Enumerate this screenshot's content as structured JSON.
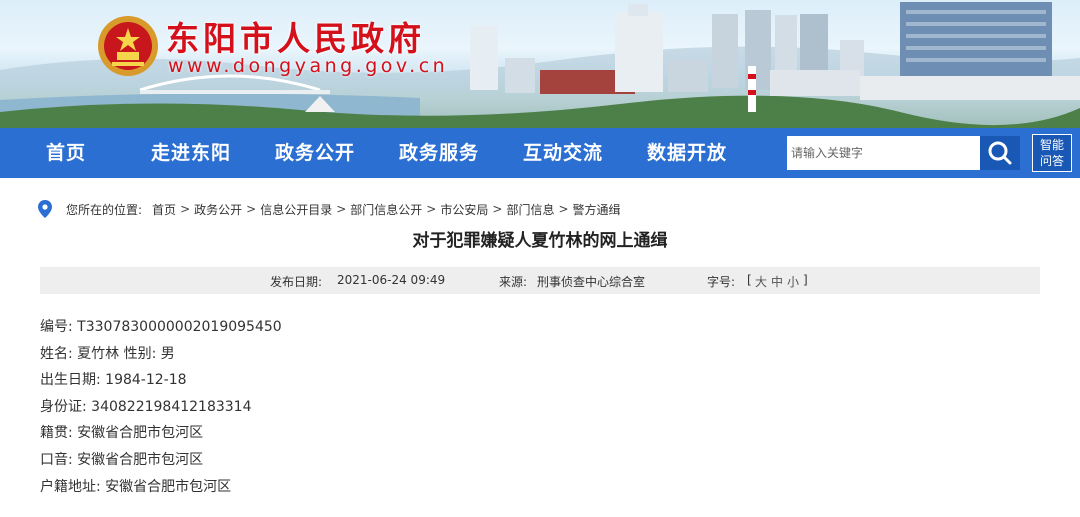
{
  "header": {
    "site_title": "东阳市人民政府",
    "site_url": "www.dongyang.gov.cn",
    "emblem_icon": "national-emblem-icon"
  },
  "nav": {
    "items": [
      {
        "label": "首页"
      },
      {
        "label": "走进东阳"
      },
      {
        "label": "政务公开"
      },
      {
        "label": "政务服务"
      },
      {
        "label": "互动交流"
      },
      {
        "label": "数据开放"
      }
    ],
    "search": {
      "placeholder": "请输入关键字",
      "icon": "search-icon"
    },
    "qa_button": {
      "line1": "智能",
      "line2": "问答"
    },
    "colors": {
      "bar": "#2b6fd3",
      "accent": "#1a58b5"
    }
  },
  "breadcrumb": {
    "label": "您所在的位置:",
    "icon": "location-pin-icon",
    "items": [
      "首页",
      "政务公开",
      "信息公开目录",
      "部门信息公开",
      "市公安局",
      "部门信息",
      "警方通缉"
    ],
    "separator": ">"
  },
  "article": {
    "title": "对于犯罪嫌疑人夏竹林的网上通缉",
    "date_label": "发布日期:",
    "date_value": "2021-06-24 09:49",
    "source_label": "来源:",
    "source_value": "刑事侦查中心综合室",
    "font_label": "字号:",
    "font_open": "[",
    "font_large": "大",
    "font_medium": "中",
    "font_small": "小",
    "font_close": "]",
    "fields": [
      "编号: T3307830000002019095450",
      "姓名: 夏竹林 性别: 男",
      "出生日期:  1984-12-18",
      "身份证:  340822198412183314",
      "籍贯: 安徽省合肥市包河区",
      "口音: 安徽省合肥市包河区",
      "户籍地址: 安徽省合肥市包河区"
    ]
  },
  "colors": {
    "title_red": "#d4101b",
    "meta_bg": "#eeeeee"
  }
}
